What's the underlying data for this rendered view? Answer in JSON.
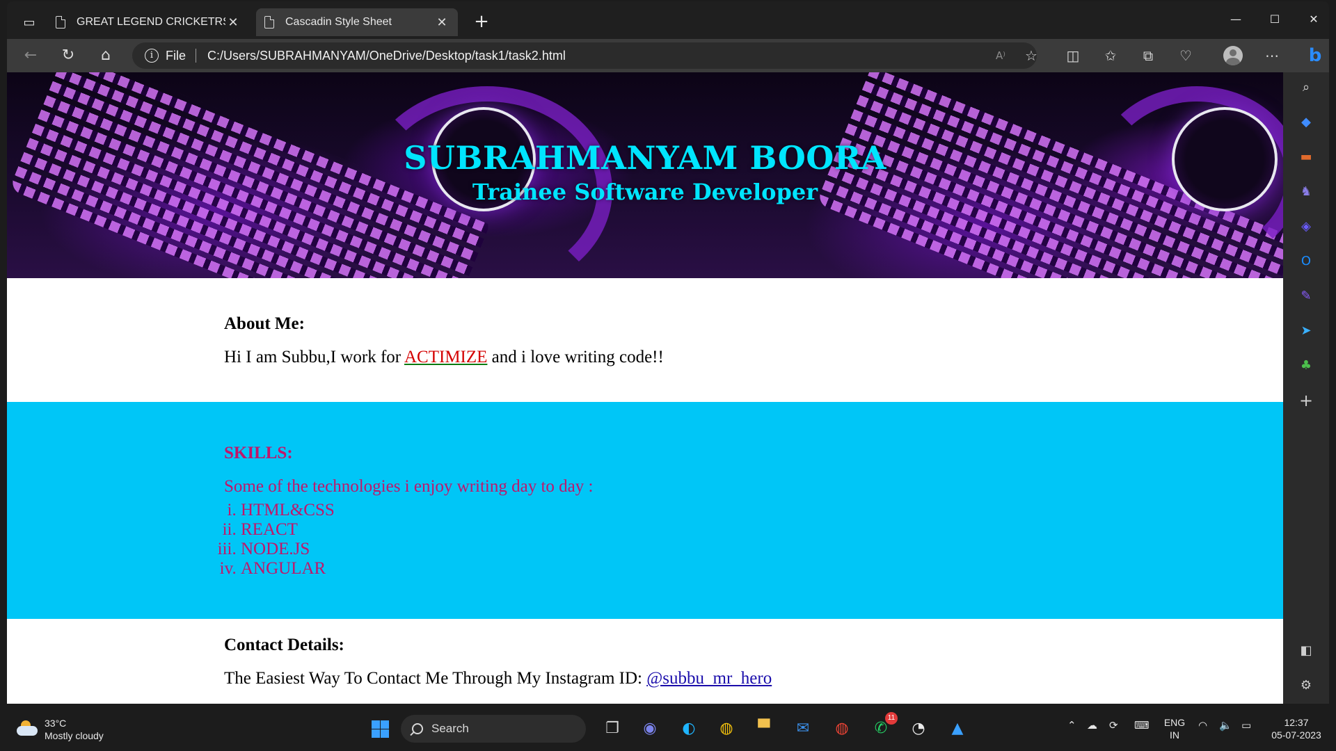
{
  "browser": {
    "tabs": [
      {
        "title": "GREAT LEGEND CRICKETRS"
      },
      {
        "title": "Cascadin Style Sheet"
      }
    ],
    "address": {
      "scheme_label": "File",
      "url": "C:/Users/SUBRAHMANYAM/OneDrive/Desktop/task1/task2.html"
    }
  },
  "page": {
    "banner": {
      "name": "SUBRAHMANYAM BOORA",
      "role": "Trainee Software Developer"
    },
    "about": {
      "heading": "About Me:",
      "text_before": "Hi I am Subbu,I work for ",
      "company": "ACTIMIZE",
      "text_after": " and i love writing code!!"
    },
    "skills": {
      "heading": "SKILLS:",
      "intro": "Some of the technologies i enjoy writing day to day :",
      "items": [
        "HTML&CSS",
        "REACT",
        "NODE.JS",
        "ANGULAR"
      ]
    },
    "contact": {
      "heading": "Contact Details:",
      "text": "The Easiest Way To Contact Me Through My Instagram ID: ",
      "handle": "@subbu_mr_hero"
    }
  },
  "taskbar": {
    "weather": {
      "temp": "33°C",
      "condition": "Mostly cloudy"
    },
    "search_label": "Search",
    "whatsapp_badge": "11",
    "language": {
      "line1": "ENG",
      "line2": "IN"
    },
    "clock": {
      "time": "12:37",
      "date": "05-07-2023"
    }
  },
  "colors": {
    "banner_text": "#00e5ff",
    "skills_bg": "#00c6f7",
    "skills_text": "#c0166a",
    "company_link": "#d40000",
    "contact_link": "#1a0dab"
  }
}
